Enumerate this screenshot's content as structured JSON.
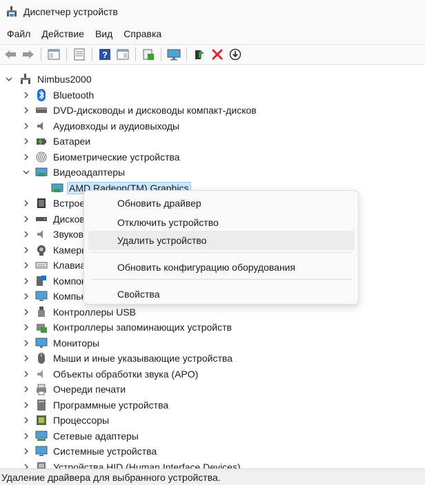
{
  "window": {
    "title": "Диспетчер устройств",
    "icon": "device-manager-icon"
  },
  "menubar": {
    "items": [
      "Файл",
      "Действие",
      "Вид",
      "Справка"
    ]
  },
  "toolbar": {
    "buttons": [
      "back-icon",
      "forward-icon",
      "properties-panel-icon",
      "list-view-icon",
      "help-icon",
      "details-icon",
      "scan-hardware-icon",
      "monitor-icon",
      "update-driver-icon",
      "remove-icon",
      "download-icon"
    ]
  },
  "tree": {
    "root": "Nimbus2000",
    "items": [
      {
        "label": "Bluetooth",
        "icon": "bluetooth-icon"
      },
      {
        "label": "DVD-дисководы и дисководы компакт-дисков",
        "icon": "dvd-drive-icon"
      },
      {
        "label": "Аудиовходы и аудиовыходы",
        "icon": "speaker-icon"
      },
      {
        "label": "Батареи",
        "icon": "battery-icon"
      },
      {
        "label": "Биометрические устройства",
        "icon": "fingerprint-icon"
      },
      {
        "label": "Видеоадаптеры",
        "icon": "display-adapter-icon",
        "expanded": true
      },
      {
        "label": "AMD Radeon(TM) Graphics",
        "icon": "display-adapter-icon",
        "child": true,
        "selected": true
      },
      {
        "label": "Встроенное ПО",
        "icon": "firmware-icon"
      },
      {
        "label": "Дисковые устройства",
        "icon": "disk-drive-icon"
      },
      {
        "label": "Звуковые, игровые и видеоустройства",
        "icon": "sound-icon"
      },
      {
        "label": "Камеры",
        "icon": "camera-icon"
      },
      {
        "label": "Клавиатуры",
        "icon": "keyboard-icon"
      },
      {
        "label": "Компоненты программного обеспечения",
        "icon": "software-component-icon"
      },
      {
        "label": "Компьютер",
        "icon": "computer-icon"
      },
      {
        "label": "Контроллеры USB",
        "icon": "usb-icon"
      },
      {
        "label": "Контроллеры запоминающих устройств",
        "icon": "storage-controller-icon"
      },
      {
        "label": "Мониторы",
        "icon": "monitor-icon"
      },
      {
        "label": "Мыши и иные указывающие устройства",
        "icon": "mouse-icon"
      },
      {
        "label": "Объекты обработки звука (APO)",
        "icon": "audio-processing-icon"
      },
      {
        "label": "Очереди печати",
        "icon": "printer-icon"
      },
      {
        "label": "Программные устройства",
        "icon": "software-device-icon"
      },
      {
        "label": "Процессоры",
        "icon": "processor-icon"
      },
      {
        "label": "Сетевые адаптеры",
        "icon": "network-adapter-icon"
      },
      {
        "label": "Системные устройства",
        "icon": "system-device-icon"
      },
      {
        "label": "Устройства HID (Human Interface Devices)",
        "icon": "hid-icon"
      }
    ]
  },
  "context_menu": {
    "items": [
      {
        "label": "Обновить драйвер"
      },
      {
        "label": "Отключить устройство"
      },
      {
        "label": "Удалить устройство",
        "hover": true
      },
      {
        "label": "Обновить конфигурацию оборудования"
      },
      {
        "label": "Свойства"
      }
    ]
  },
  "statusbar": {
    "text": "Удаление драйвера для выбранного устройства."
  },
  "colors": {
    "selection": "#cce8ff",
    "selection_border": "#99d1ff",
    "hover": "#ececec",
    "accent": "#0078d4"
  }
}
